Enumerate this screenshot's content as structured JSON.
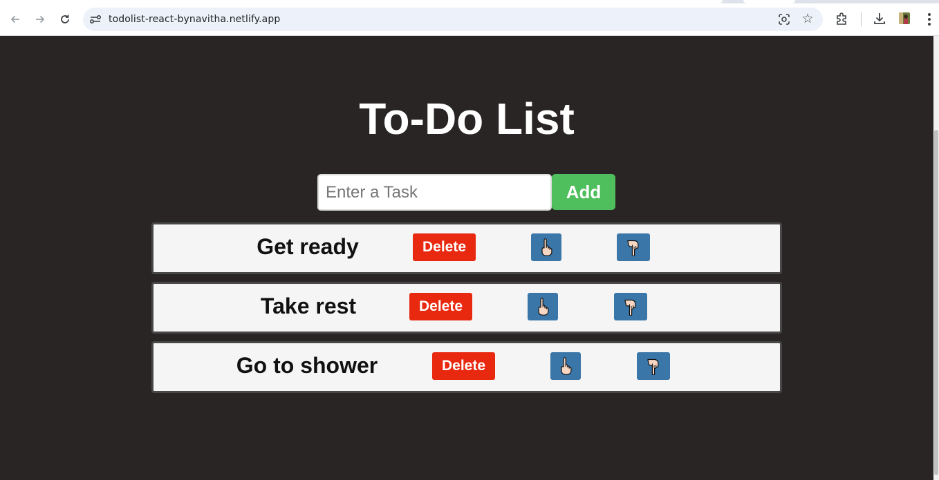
{
  "browser": {
    "url": "todolist-react-bynavitha.netlify.app",
    "icons": {
      "back": "back-arrow-icon",
      "forward": "forward-arrow-icon",
      "reload": "reload-icon",
      "site_info": "site-info-icon",
      "lens": "google-lens-icon",
      "bookmark": "star-icon",
      "extensions": "puzzle-icon",
      "downloads": "download-icon",
      "menu": "kebab-menu-icon"
    }
  },
  "app": {
    "title": "To-Do List",
    "input_placeholder": "Enter a Task",
    "add_label": "Add",
    "colors": {
      "background": "#292524",
      "add": "#4fbe5c",
      "delete": "#e8290f",
      "move": "#3b76a8"
    },
    "tasks": [
      {
        "text": "Get ready",
        "delete_label": "Delete",
        "up_icon": "👆",
        "down_icon": "👇"
      },
      {
        "text": "Take rest",
        "delete_label": "Delete",
        "up_icon": "👆",
        "down_icon": "👇"
      },
      {
        "text": "Go to shower",
        "delete_label": "Delete",
        "up_icon": "👆",
        "down_icon": "👇"
      }
    ]
  }
}
